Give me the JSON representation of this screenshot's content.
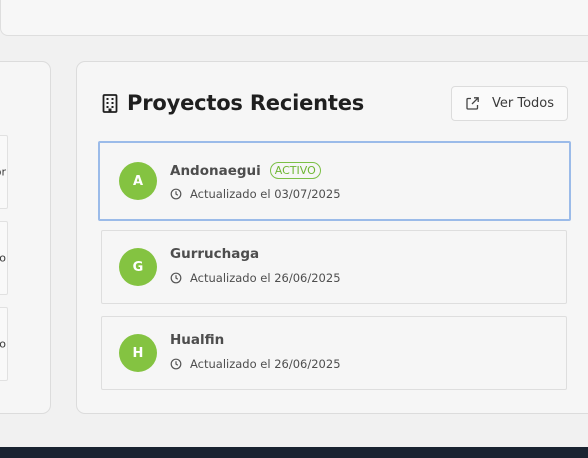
{
  "left_cards": [
    {
      "text": "dor"
    },
    {
      "text": "o"
    },
    {
      "text": "uipo"
    }
  ],
  "panel": {
    "title": "Proyectos Recientes",
    "icon": "building-icon",
    "view_all_label": "Ver Todos",
    "view_all_icon": "external-link-icon"
  },
  "projects": [
    {
      "initial": "A",
      "name": "Andonaegui",
      "badge": "ACTIVO",
      "updated": "Actualizado el 03/07/2025"
    },
    {
      "initial": "G",
      "name": "Gurruchaga",
      "badge": "",
      "updated": "Actualizado el 26/06/2025"
    },
    {
      "initial": "H",
      "name": "Hualfin",
      "badge": "",
      "updated": "Actualizado el 26/06/2025"
    }
  ],
  "colors": {
    "avatar": "#84c341",
    "badge": "#6fb634",
    "selected_border": "#9bbbe9",
    "bottom_bar": "#1a2331"
  }
}
